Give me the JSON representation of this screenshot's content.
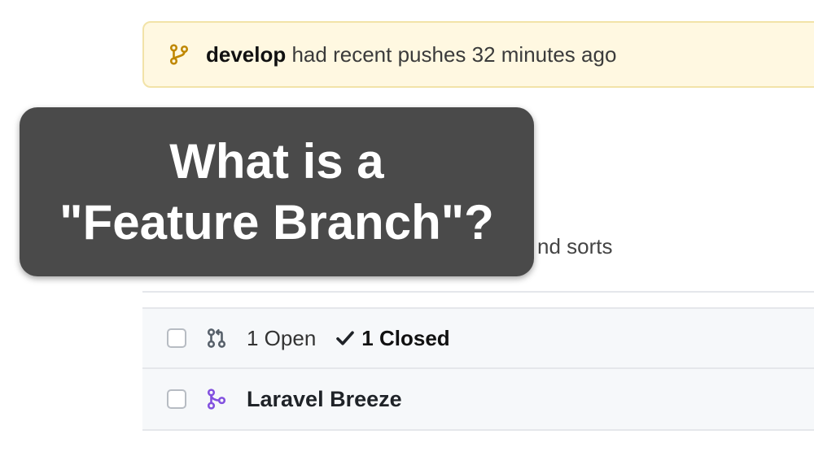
{
  "banner": {
    "branch_name": "develop",
    "suffix_text": " had recent pushes 32 minutes ago",
    "icon": "git-branch-icon",
    "icon_color": "#bf8700"
  },
  "overlay": {
    "line1": "What is a",
    "line2": "\"Feature Branch\"?"
  },
  "filters_hint": {
    "partial_text": "nd sorts"
  },
  "list_header": {
    "open_count": "1 Open",
    "closed_count": "1 Closed",
    "pr_icon": "git-pull-request-icon",
    "check_icon": "check-icon"
  },
  "rows": [
    {
      "title": "Laravel Breeze",
      "icon": "git-merge-icon",
      "icon_color": "#8250df"
    }
  ]
}
